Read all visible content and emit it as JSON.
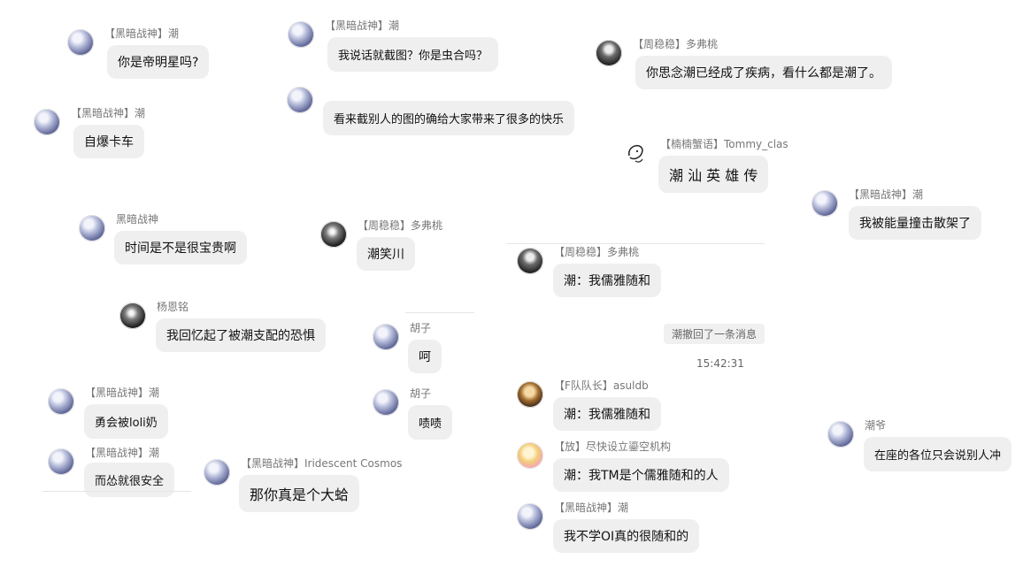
{
  "messages": [
    {
      "name": "【黑暗战神】潮",
      "text": "你是帝明星吗?"
    },
    {
      "name": "【黑暗战神】潮",
      "text": "我说话就截图？你是虫合吗？"
    },
    {
      "name": "【周稳稳】多弗桃",
      "text": "你思念潮已经成了疾病，看什么都是潮了。"
    },
    {
      "name": "【黑暗战神】潮",
      "text": "自爆卡车"
    },
    {
      "name": "",
      "text": "看来截别人的图的确给大家带来了很多的快乐"
    },
    {
      "name": "【楠楠蟹语】Tommy_clas",
      "text": "潮 汕 英 雄 传"
    },
    {
      "name": "【黑暗战神】潮",
      "text": "我被能量撞击散架了"
    },
    {
      "name": "黑暗战神",
      "text": "时间是不是很宝贵啊"
    },
    {
      "name": "【周稳稳】多弗桃",
      "text": "潮笑川"
    },
    {
      "name": "【周稳稳】多弗桃",
      "text": "潮：我儒雅随和"
    },
    {
      "name": "杨恩铭",
      "text": "我回忆起了被潮支配的恐惧"
    },
    {
      "name": "胡子",
      "text": "呵"
    },
    {
      "name": "【黑暗战神】潮",
      "text": "勇会被loli奶"
    },
    {
      "name": "胡子",
      "text": "啧啧"
    },
    {
      "name": "【F队队长】asuldb",
      "text": "潮：我儒雅随和"
    },
    {
      "name": "【放】尽快设立鎏空机构",
      "text": "潮：我TM是个儒雅随和的人"
    },
    {
      "name": "【黑暗战神】潮",
      "text": "而怂就很安全"
    },
    {
      "name": "【黑暗战神】Iridescent Cosmos",
      "text": "那你真是个大蛤"
    },
    {
      "name": "潮爷",
      "text": "在座的各位只会说别人冲"
    },
    {
      "name": "【黑暗战神】潮",
      "text": "我不学OI真的很随和的"
    }
  ],
  "system": {
    "recall_notice": "潮撤回了一条消息",
    "timestamp": "15:42:31"
  }
}
